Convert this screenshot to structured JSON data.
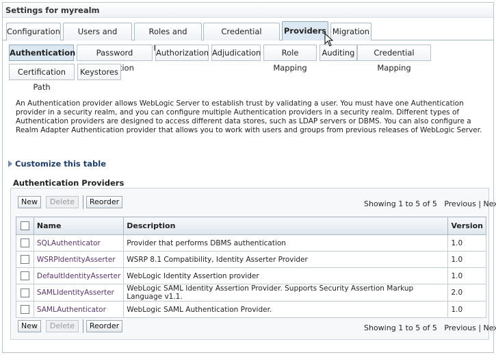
{
  "title": "Settings for myrealm",
  "tabs": [
    "Configuration",
    "Users and Groups",
    "Roles and Policies",
    "Credential Mappings",
    "Providers",
    "Migration"
  ],
  "subtabs_row1": [
    "Authentication",
    "Password Validation",
    "Authorization",
    "Adjudication",
    "Role Mapping",
    "Auditing",
    "Credential Mapping"
  ],
  "subtabs_row2": [
    "Certification Path",
    "Keystores"
  ],
  "intro": "An Authentication provider allows WebLogic Server to establish trust by validating a user. You must have one Authentication provider in a security realm, and you can configure multiple Authentication providers in a security realm. Different types of Authentication providers are designed to access different data stores, such as LDAP servers or DBMS. You can also configure a Realm Adapter Authentication provider that allows you to work with users and groups from previous releases of WebLogic Server.",
  "customize": "Customize this table",
  "section_title": "Authentication Providers",
  "buttons": {
    "new": "New",
    "delete": "Delete",
    "reorder": "Reorder"
  },
  "paging": {
    "showing": "Showing 1 to 5 of 5",
    "previous": "Previous",
    "sep": "|",
    "next": "Next"
  },
  "columns": {
    "name": "Name",
    "description": "Description",
    "version": "Version"
  },
  "rows": [
    {
      "name": "SQLAuthenticator",
      "description": "Provider that performs DBMS authentication",
      "version": "1.0"
    },
    {
      "name": "WSRPIdentityAsserter",
      "description": "WSRP 8.1 Compatibility, Identity Asserter Provider",
      "version": "1.0"
    },
    {
      "name": "DefaultIdentityAsserter",
      "description": "WebLogic Identity Assertion provider",
      "version": "1.0"
    },
    {
      "name": "SAMLIdentityAsserter",
      "description": "WebLogic SAML Identity Assertion Provider. Supports Security Assertion Markup Language v1.1.",
      "version": "2.0"
    },
    {
      "name": "SAMLAuthenticator",
      "description": "WebLogic SAML Authentication Provider.",
      "version": "1.0"
    }
  ]
}
